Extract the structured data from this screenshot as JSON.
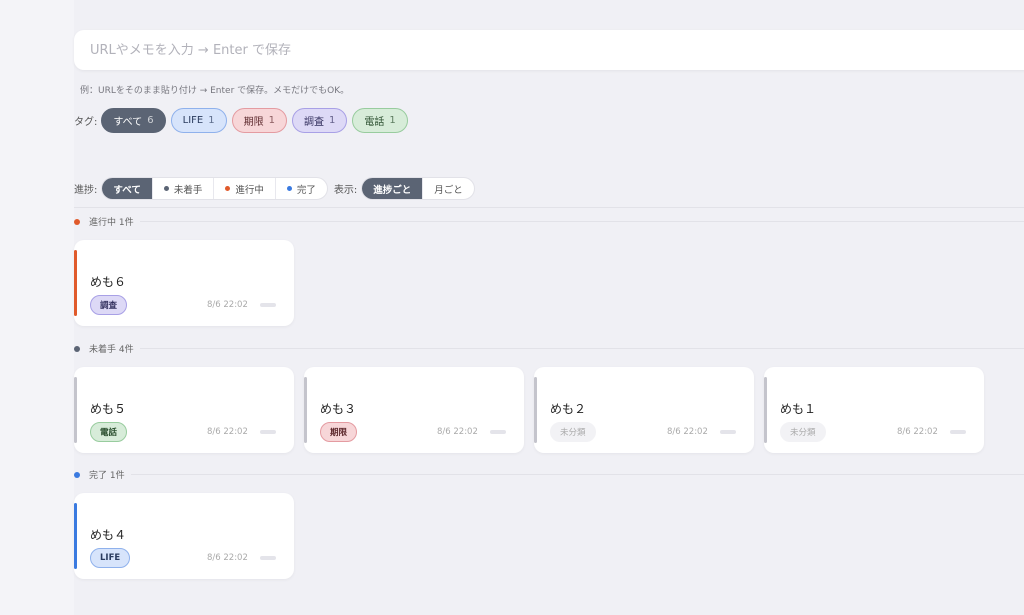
{
  "search": {
    "placeholder": "URLやメモを入力 → Enter で保存",
    "value": ""
  },
  "hint": "例：URLをそのまま貼り付け → Enter で保存。メモだけでもOK。",
  "tags": {
    "label": "タグ:",
    "items": [
      {
        "label": "すべて",
        "count": "6"
      },
      {
        "label": "LIFE",
        "count": "1"
      },
      {
        "label": "期限",
        "count": "1"
      },
      {
        "label": "調査",
        "count": "1"
      },
      {
        "label": "電話",
        "count": "1"
      }
    ]
  },
  "progress_filter": {
    "label": "進捗:",
    "options": [
      "すべて",
      "未着手",
      "進行中",
      "完了"
    ]
  },
  "view_filter": {
    "label": "表示:",
    "options": [
      "進捗ごと",
      "月ごと"
    ]
  },
  "sections": {
    "in_progress": {
      "title": "進行中 1件",
      "cards": [
        {
          "title": "めも６",
          "tag": "調査",
          "time": "8/6 22:02"
        }
      ]
    },
    "not_started": {
      "title": "未着手 4件",
      "cards": [
        {
          "title": "めも５",
          "tag": "電話",
          "time": "8/6 22:02"
        },
        {
          "title": "めも３",
          "tag": "期限",
          "time": "8/6 22:02"
        },
        {
          "title": "めも２",
          "tag": "未分類",
          "time": "8/6 22:02"
        },
        {
          "title": "めも１",
          "tag": "未分類",
          "time": "8/6 22:02"
        }
      ]
    },
    "done": {
      "title": "完了 1件",
      "cards": [
        {
          "title": "めも４",
          "tag": "LIFE",
          "time": "8/6 22:02"
        }
      ]
    }
  },
  "colors": {
    "accent": "#5b6474",
    "in_progress": "#e05a2b",
    "not_started": "#5b6474",
    "done": "#3a7ae0"
  }
}
